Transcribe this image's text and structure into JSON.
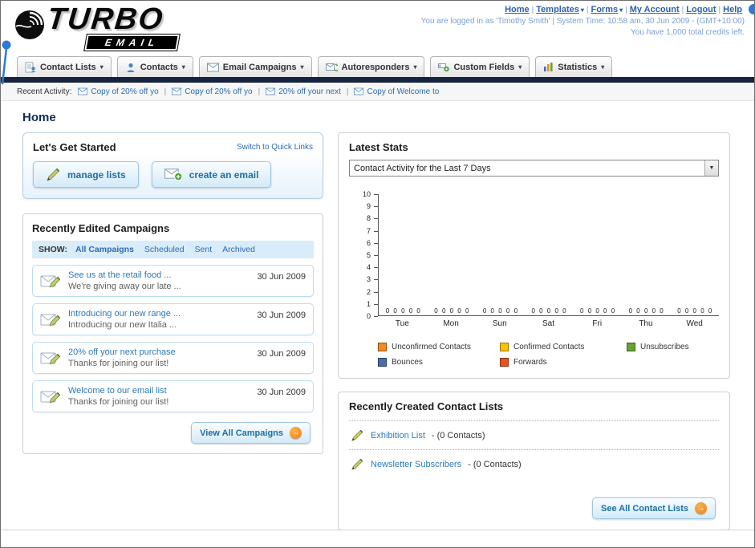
{
  "page_title": "Home",
  "header": {
    "logo_primary": "TURBO",
    "logo_secondary": "EMAIL",
    "nav_links": [
      {
        "label": "Home",
        "dropdown": false
      },
      {
        "label": "Templates",
        "dropdown": true
      },
      {
        "label": "Forms",
        "dropdown": true
      },
      {
        "label": "My Account",
        "dropdown": false
      },
      {
        "label": "Logout",
        "dropdown": false
      },
      {
        "label": "Help",
        "dropdown": false
      }
    ],
    "login_info": "You are logged in as 'Timothy Smith' | System Time: 10:58 am, 30 Jun 2009 - (GMT+10:00)",
    "credits_info": "You have 1,000 total credits left."
  },
  "nav_tabs": [
    {
      "label": "Contact Lists",
      "icon": "contact-lists-icon"
    },
    {
      "label": "Contacts",
      "icon": "contacts-icon"
    },
    {
      "label": "Email Campaigns",
      "icon": "email-campaigns-icon"
    },
    {
      "label": "Autoresponders",
      "icon": "autoresponders-icon"
    },
    {
      "label": "Custom Fields",
      "icon": "custom-fields-icon"
    },
    {
      "label": "Statistics",
      "icon": "statistics-icon"
    }
  ],
  "recent_activity": {
    "label": "Recent Activity:",
    "items": [
      "Copy of 20% off yo",
      "Copy of 20% off yo",
      "20% off your next",
      "Copy of Welcome to"
    ]
  },
  "get_started": {
    "title": "Let's Get Started",
    "switch_link": "Switch to Quick Links",
    "buttons": [
      {
        "label": "manage lists"
      },
      {
        "label": "create an email"
      }
    ]
  },
  "campaigns": {
    "title": "Recently Edited Campaigns",
    "show_label": "SHOW:",
    "filters": [
      "All Campaigns",
      "Scheduled",
      "Sent",
      "Archived"
    ],
    "active_filter": "All Campaigns",
    "items": [
      {
        "title": "See us at the retail food ...",
        "subtitle": "We're giving away our late ...",
        "date": "30 Jun 2009"
      },
      {
        "title": "Introducing our new range ...",
        "subtitle": "Introducing our new Italia ...",
        "date": "30 Jun 2009"
      },
      {
        "title": "20% off your next purchase",
        "subtitle": "Thanks for joining our list!",
        "date": "30 Jun 2009"
      },
      {
        "title": "Welcome to our email list",
        "subtitle": "Thanks for joining our list!",
        "date": "30 Jun 2009"
      }
    ],
    "view_all_label": "View All Campaigns"
  },
  "stats": {
    "title": "Latest Stats",
    "dropdown_value": "Contact Activity for the Last 7 Days"
  },
  "chart_data": {
    "type": "bar",
    "title": "Contact Activity for the Last 7 Days",
    "categories": [
      "Tue",
      "Mon",
      "Sun",
      "Sat",
      "Fri",
      "Thu",
      "Wed"
    ],
    "series": [
      {
        "name": "Unconfirmed Contacts",
        "color": "#f6891f",
        "values": [
          0,
          0,
          0,
          0,
          0,
          0,
          0
        ]
      },
      {
        "name": "Confirmed Contacts",
        "color": "#fdc200",
        "values": [
          0,
          0,
          0,
          0,
          0,
          0,
          0
        ]
      },
      {
        "name": "Unsubscribes",
        "color": "#64a433",
        "values": [
          0,
          0,
          0,
          0,
          0,
          0,
          0
        ]
      },
      {
        "name": "Bounces",
        "color": "#4a6da7",
        "values": [
          0,
          0,
          0,
          0,
          0,
          0,
          0
        ]
      },
      {
        "name": "Forwards",
        "color": "#e8521f",
        "values": [
          0,
          0,
          0,
          0,
          0,
          0,
          0
        ]
      }
    ],
    "ylim": [
      0,
      10
    ],
    "ytick_step": 1,
    "grid": false,
    "legend_position": "bottom",
    "value_labels_shown": true
  },
  "contact_lists": {
    "title": "Recently Created Contact Lists",
    "items": [
      {
        "name": "Exhibition List",
        "detail": "- (0 Contacts)"
      },
      {
        "name": "Newsletter Subscribers",
        "detail": "- (0 Contacts)"
      }
    ],
    "see_all_label": "See All Contact Lists"
  }
}
